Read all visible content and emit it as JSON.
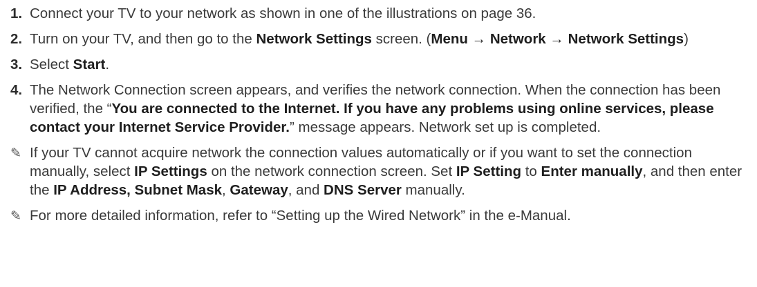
{
  "steps": [
    {
      "num": "1.",
      "parts": [
        {
          "t": "Connect your TV to your network as shown in one of the illustrations on page 36."
        }
      ]
    },
    {
      "num": "2.",
      "parts": [
        {
          "t": "Turn on your TV, and then go to the "
        },
        {
          "t": "Network Settings",
          "b": true
        },
        {
          "t": " screen. ("
        },
        {
          "t": "Menu",
          "b": true
        },
        {
          "t": " → ",
          "b": true
        },
        {
          "t": "Network",
          "b": true
        },
        {
          "t": " → ",
          "b": true
        },
        {
          "t": "Network Settings",
          "b": true
        },
        {
          "t": ")"
        }
      ]
    },
    {
      "num": "3.",
      "parts": [
        {
          "t": "Select "
        },
        {
          "t": "Start",
          "b": true
        },
        {
          "t": "."
        }
      ]
    },
    {
      "num": "4.",
      "parts": [
        {
          "t": "The Network Connection screen appears, and verifies the network connection. When the connection has been verified, the “"
        },
        {
          "t": "You are connected to the Internet. If you have any problems using online services, please contact your Internet Service Provider.",
          "b": true
        },
        {
          "t": "” message appears. Network set up is completed."
        }
      ]
    }
  ],
  "notes": [
    {
      "icon": "pencil-note-icon",
      "parts": [
        {
          "t": "If your TV cannot acquire network the connection values automatically or if you want to set the connection manually, select "
        },
        {
          "t": "IP Settings",
          "b": true
        },
        {
          "t": " on the network connection screen. Set "
        },
        {
          "t": "IP Setting",
          "b": true
        },
        {
          "t": " to "
        },
        {
          "t": "Enter manually",
          "b": true
        },
        {
          "t": ", and then enter the "
        },
        {
          "t": "IP Address, Subnet Mask",
          "b": true
        },
        {
          "t": ", "
        },
        {
          "t": "Gateway",
          "b": true
        },
        {
          "t": ", and "
        },
        {
          "t": "DNS Server",
          "b": true
        },
        {
          "t": " manually."
        }
      ]
    },
    {
      "icon": "pencil-note-icon",
      "parts": [
        {
          "t": "For more detailed information, refer to “Setting up the Wired Network” in the e-Manual."
        }
      ]
    }
  ]
}
